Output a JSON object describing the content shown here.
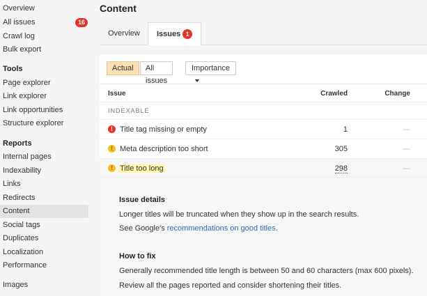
{
  "sidebar": {
    "top_items": [
      {
        "label": "Overview"
      },
      {
        "label": "All issues",
        "badge": "16"
      },
      {
        "label": "Crawl log"
      },
      {
        "label": "Bulk export"
      }
    ],
    "tools_heading": "Tools",
    "tools_items": [
      {
        "label": "Page explorer"
      },
      {
        "label": "Link explorer"
      },
      {
        "label": "Link opportunities"
      },
      {
        "label": "Structure explorer"
      }
    ],
    "reports_heading": "Reports",
    "reports_items": [
      {
        "label": "Internal pages"
      },
      {
        "label": "Indexability"
      },
      {
        "label": "Links"
      },
      {
        "label": "Redirects"
      },
      {
        "label": "Content"
      },
      {
        "label": "Social tags"
      },
      {
        "label": "Duplicates"
      },
      {
        "label": "Localization"
      },
      {
        "label": "Performance"
      }
    ],
    "extra_item": "Images"
  },
  "main": {
    "title": "Content",
    "tabs": [
      {
        "label": "Overview"
      },
      {
        "label": "Issues",
        "badge": "1"
      }
    ],
    "toolbar": {
      "actual": "Actual",
      "all_issues": "All issues",
      "importance": "Importance"
    },
    "table": {
      "columns": {
        "issue": "Issue",
        "crawled": "Crawled",
        "change": "Change"
      },
      "section": "INDEXABLE",
      "rows": [
        {
          "icon": "!",
          "name": "Title tag missing or empty",
          "crawled": "1",
          "change": "—"
        },
        {
          "icon": "!",
          "name": "Meta description too short",
          "crawled": "305",
          "change": "—"
        },
        {
          "icon": "!",
          "name": "Title too long",
          "crawled": "298",
          "change": "—"
        }
      ]
    },
    "details": {
      "issue_heading": "Issue details",
      "issue_line1": "Longer titles will be truncated when they show up in the search results.",
      "issue_line2_prefix": "See Google's ",
      "issue_line2_link": "recommendations on good titles",
      "issue_line2_suffix": ".",
      "fix_heading": "How to fix",
      "fix_line1": "Generally recommended title length is between 50 and 60 characters (max 600 pixels).",
      "fix_line2": "Review all the pages reported and consider shortening their titles."
    }
  },
  "colors": {
    "accent_red": "#e5332a",
    "warning_yellow": "#f3c020",
    "link_blue": "#2a6bb3",
    "toggle_active": "#fbe0b5",
    "highlight": "#fff7a8"
  }
}
